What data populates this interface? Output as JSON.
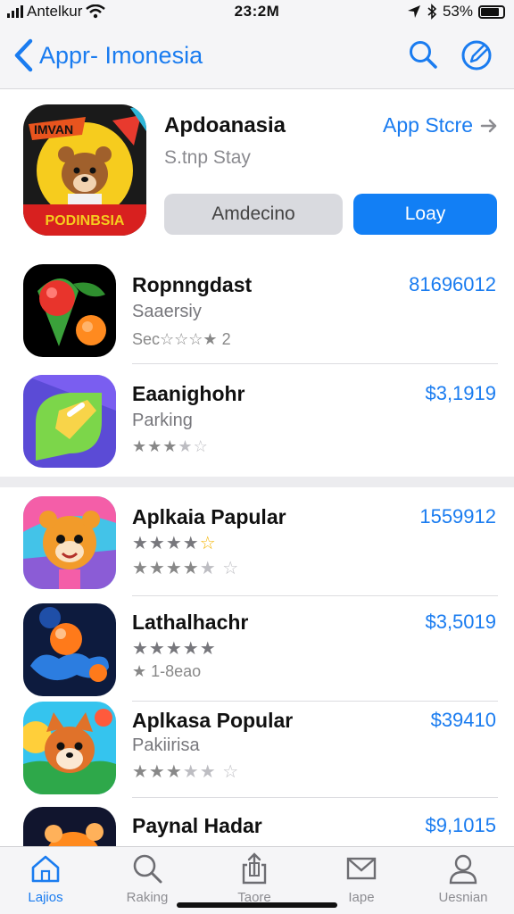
{
  "status_bar": {
    "carrier": "Antelkur",
    "time": "23:2M",
    "battery": "53%"
  },
  "nav": {
    "back_label": "Appr- Imonesia"
  },
  "featured": {
    "title": "Apdoanasia",
    "subtitle": "S.tnp Stay",
    "link_label": "App Stcre",
    "icon_text_top": "IMVAN",
    "icon_text_bottom": "PODINBSIA",
    "secondary_button": "Amdecino",
    "primary_button": "Loay"
  },
  "apps": [
    {
      "name": "Ropnngdast",
      "line2": "Saaersiy",
      "line3": "Sec☆☆☆★ 2",
      "price": "81696012",
      "stars": null
    },
    {
      "name": "Eaanighohr",
      "line2": "Parking",
      "line3": "",
      "price": "$3,1919",
      "stars": "3/5"
    },
    {
      "name": "Aplkaia Papular",
      "line2": "",
      "line3": "",
      "price": "1559912",
      "stars": "4.5/5",
      "stars2": "4/5"
    },
    {
      "name": "Lathalhachr",
      "line2": "",
      "line3": "★ 1-8eao",
      "price": "$3,5019",
      "stars": "5/5"
    },
    {
      "name": "Aplkasa Popular",
      "line2": "Pakiirisa",
      "line3": "",
      "price": "$39410",
      "stars": "3/5"
    },
    {
      "name": "Paynal Hadar",
      "line2": "",
      "line3": "",
      "price": "$9,1015",
      "stars": null
    }
  ],
  "tabs": [
    {
      "label": "Lajios",
      "icon": "home-icon",
      "active": true
    },
    {
      "label": "Raking",
      "icon": "search-icon",
      "active": false
    },
    {
      "label": "Taore",
      "icon": "share-icon",
      "active": false
    },
    {
      "label": "Iape",
      "icon": "mail-icon",
      "active": false
    },
    {
      "label": "Uesnian",
      "icon": "person-icon",
      "active": false
    }
  ],
  "colors": {
    "accent": "#127ff5",
    "link": "#1a7cf0",
    "star": "#f4b400"
  }
}
